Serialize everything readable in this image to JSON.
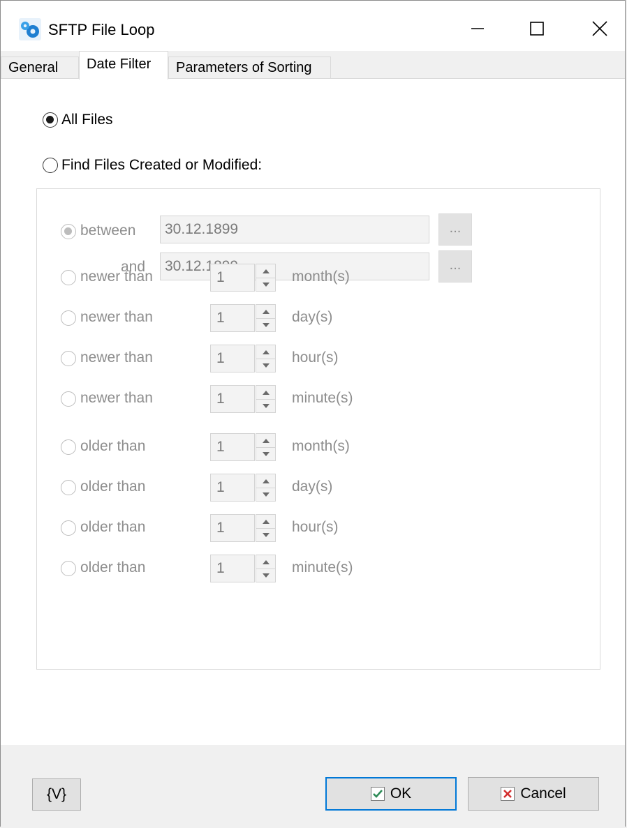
{
  "window": {
    "title": "SFTP File Loop",
    "controls": {
      "minimize": "minimize-icon",
      "maximize": "maximize-icon",
      "close": "close-icon"
    }
  },
  "tabs": [
    {
      "label": "General",
      "active": false
    },
    {
      "label": "Date Filter",
      "active": true
    },
    {
      "label": "Parameters of Sorting",
      "active": false
    }
  ],
  "date_filter": {
    "all_files_label": "All Files",
    "all_files_selected": true,
    "find_files_label": "Find Files Created or Modified:",
    "find_files_selected": false,
    "between_label": "between",
    "between_value": "30.12.1899",
    "and_label": "and",
    "and_value": "30.12.1899",
    "picker_label": "...",
    "rows": [
      {
        "label": "newer than",
        "value": "1",
        "unit": "month(s)"
      },
      {
        "label": "newer than",
        "value": "1",
        "unit": "day(s)"
      },
      {
        "label": "newer than",
        "value": "1",
        "unit": "hour(s)"
      },
      {
        "label": "newer than",
        "value": "1",
        "unit": "minute(s)"
      },
      {
        "label": "older than",
        "value": "1",
        "unit": "month(s)"
      },
      {
        "label": "older than",
        "value": "1",
        "unit": "day(s)"
      },
      {
        "label": "older than",
        "value": "1",
        "unit": "hour(s)"
      },
      {
        "label": "older than",
        "value": "1",
        "unit": "minute(s)"
      }
    ]
  },
  "footer": {
    "variables_label": "{V}",
    "ok_label": "OK",
    "cancel_label": "Cancel"
  },
  "colors": {
    "accent": "#0078d7",
    "ok_check": "#2e8b57",
    "cancel_x": "#d32f2f"
  }
}
